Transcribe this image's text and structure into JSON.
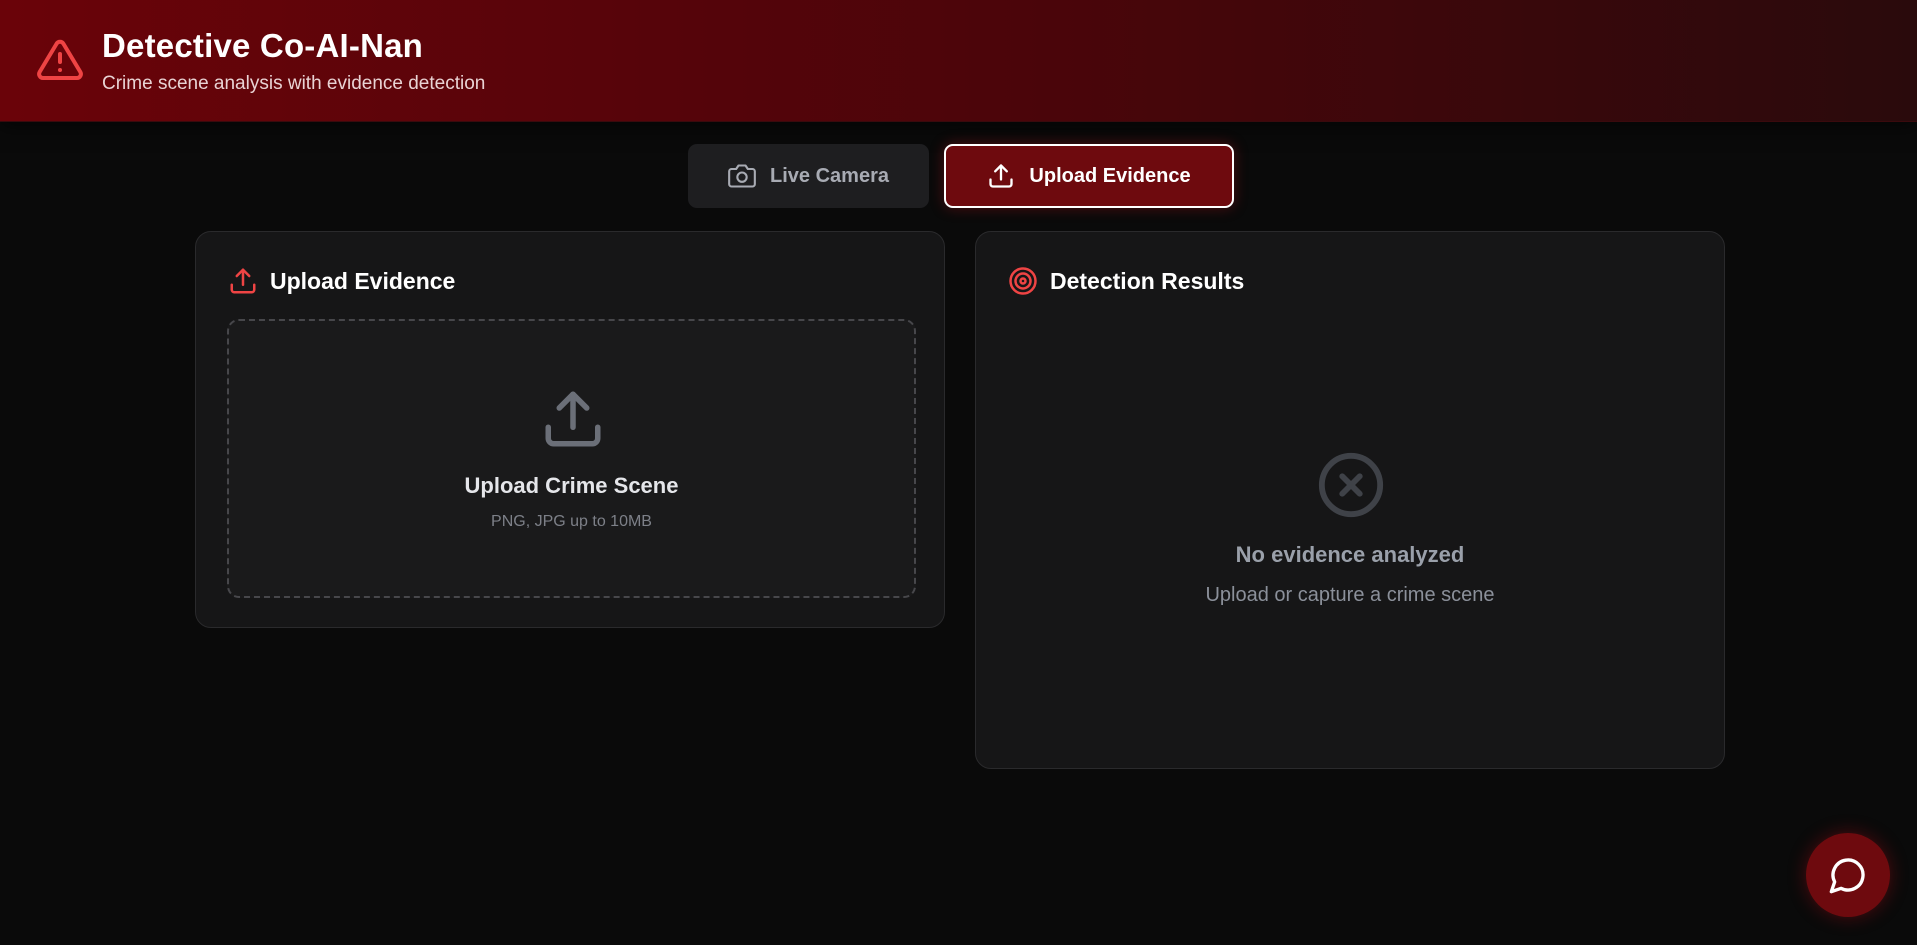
{
  "header": {
    "title": "Detective Co-AI-Nan",
    "subtitle": "Crime scene analysis with evidence detection",
    "icon": "alert-triangle-icon"
  },
  "mode_tabs": [
    {
      "label": "Live Camera",
      "icon": "camera-icon",
      "active": false
    },
    {
      "label": "Upload Evidence",
      "icon": "upload-icon",
      "active": true
    }
  ],
  "upload_panel": {
    "title": "Upload Evidence",
    "icon": "upload-icon",
    "dropzone": {
      "title": "Upload Crime Scene",
      "hint": "PNG, JPG up to 10MB",
      "icon": "upload-icon"
    }
  },
  "results_panel": {
    "title": "Detection Results",
    "icon": "target-icon",
    "empty": {
      "title": "No evidence analyzed",
      "hint": "Upload or capture a crime scene",
      "icon": "x-circle-icon"
    }
  },
  "chat_button": {
    "icon": "chat-bubble-icon"
  },
  "colors": {
    "brand_red": "#6e0a0e",
    "accent_red": "#ef4444",
    "background": "#0a0a0a",
    "panel": "#161617"
  }
}
